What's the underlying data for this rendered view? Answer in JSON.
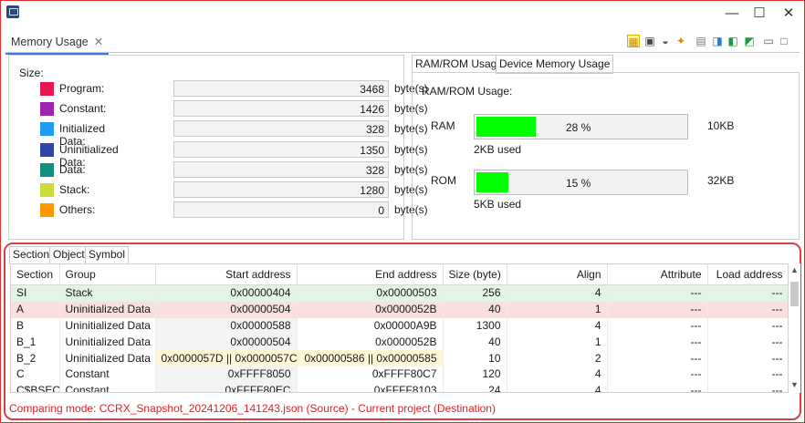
{
  "window": {
    "minimize": "—",
    "maximize": "☐",
    "close": "✕"
  },
  "view_tab": {
    "label": "Memory Usage",
    "close": "✕"
  },
  "size_panel": {
    "label": "Size:",
    "rows": [
      {
        "label": "Program:",
        "value": "3468",
        "unit": "byte(s)",
        "color": "#e8174f"
      },
      {
        "label": "Constant:",
        "value": "1426",
        "unit": "byte(s)",
        "color": "#9b27b0"
      },
      {
        "label": "Initialized Data:",
        "value": "328",
        "unit": "byte(s)",
        "color": "#1e9cf0"
      },
      {
        "label": "Uninitialized Data:",
        "value": "1350",
        "unit": "byte(s)",
        "color": "#2e46a6"
      },
      {
        "label": "Data:",
        "value": "328",
        "unit": "byte(s)",
        "color": "#12907f"
      },
      {
        "label": "Stack:",
        "value": "1280",
        "unit": "byte(s)",
        "color": "#cddc39"
      },
      {
        "label": "Others:",
        "value": "0",
        "unit": "byte(s)",
        "color": "#ff9800"
      }
    ]
  },
  "rr_tabs": {
    "ramrom": "RAM/ROM Usage",
    "device": "Device Memory Usage"
  },
  "rr_panel": {
    "title": "RAM/ROM Usage:",
    "ram": {
      "label": "RAM",
      "percent": "28 %",
      "fill": 0.28,
      "total": "10KB",
      "used": "2KB used"
    },
    "rom": {
      "label": "ROM",
      "percent": "15 %",
      "fill": 0.15,
      "total": "32KB",
      "used": "5KB used"
    }
  },
  "section_tabs": {
    "section": "Section",
    "object": "Object",
    "symbol": "Symbol"
  },
  "table": {
    "headers": [
      "Section",
      "Group",
      "Start address",
      "End address",
      "Size (byte)",
      "Align",
      "Attribute",
      "Load address"
    ],
    "rows": [
      {
        "cells": [
          "SI",
          "Stack",
          "0x00000404",
          "0x00000503",
          "256",
          "4",
          "---",
          "---"
        ],
        "bg": "#e3f4e6"
      },
      {
        "cells": [
          "A",
          "Uninitialized Data",
          "0x00000504",
          "0x0000052B",
          "40",
          "1",
          "---",
          "---"
        ],
        "bg": "#f9e0df"
      },
      {
        "cells": [
          "B",
          "Uninitialized Data",
          "0x00000588",
          "0x00000A9B",
          "1300",
          "4",
          "---",
          "---"
        ],
        "bg": "#ffffff"
      },
      {
        "cells": [
          "B_1",
          "Uninitialized Data",
          "0x00000504",
          "0x0000052B",
          "40",
          "1",
          "---",
          "---"
        ],
        "bg": "#ffffff"
      },
      {
        "cells": [
          "B_2",
          "Uninitialized Data",
          "0x0000057D || 0x0000057C",
          "0x00000586 || 0x00000585",
          "10",
          "2",
          "---",
          "---"
        ],
        "bg": "#ffffff",
        "highlight": true
      },
      {
        "cells": [
          "C",
          "Constant",
          "0xFFFF8050",
          "0xFFFF80C7",
          "120",
          "4",
          "---",
          "---"
        ],
        "bg": "#ffffff"
      },
      {
        "cells": [
          "C$BSEC",
          "Constant",
          "0xFFFF80EC",
          "0xFFFF8103",
          "24",
          "4",
          "---",
          "---"
        ],
        "bg": "#ffffff"
      }
    ]
  },
  "footer": {
    "text": "Comparing mode: CCRX_Snapshot_20241206_141243.json (Source) - Current project (Destination)"
  }
}
